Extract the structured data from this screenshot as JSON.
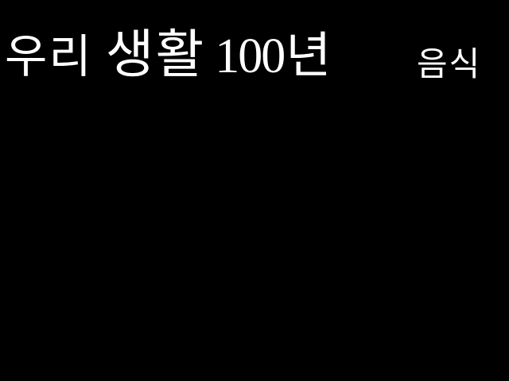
{
  "title": {
    "part1": "우리",
    "part2": "생활",
    "part3": "100",
    "part4": "년"
  },
  "subtitle": "음식",
  "colors": {
    "background": "#000000",
    "text": "#ffffff"
  }
}
